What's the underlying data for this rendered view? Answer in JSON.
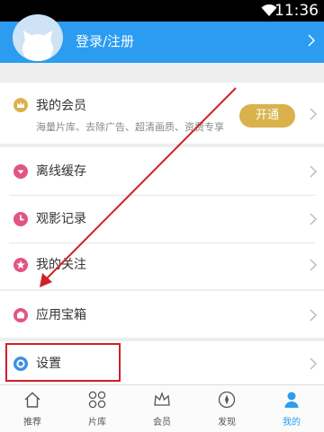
{
  "status_bar": {
    "time": "11:36",
    "wifi_icon": "wifi-icon"
  },
  "header": {
    "login_label": "登录/注册",
    "avatar_icon": "avatar-icon"
  },
  "membership": {
    "title": "我的会员",
    "subtitle": "海量片库、去除广告、超清画质、资费专享",
    "button_label": "开通",
    "icon": "crown-icon"
  },
  "menu": {
    "offline_cache": {
      "label": "离线缓存",
      "icon": "download-icon"
    },
    "history": {
      "label": "观影记录",
      "icon": "clock-icon"
    },
    "follows": {
      "label": "我的关注",
      "icon": "star-icon"
    },
    "app_box": {
      "label": "应用宝箱",
      "icon": "box-icon"
    },
    "settings": {
      "label": "设置",
      "icon": "gear-icon"
    }
  },
  "tabs": [
    {
      "label": "推荐",
      "icon": "home-icon"
    },
    {
      "label": "片库",
      "icon": "grid-icon"
    },
    {
      "label": "会员",
      "icon": "crown-icon"
    },
    {
      "label": "发现",
      "icon": "compass-icon"
    },
    {
      "label": "我的",
      "icon": "person-icon"
    }
  ],
  "active_tab": "我的",
  "colors": {
    "accent": "#2b9cf0",
    "gold": "#d9b24c",
    "pink": "#e05585",
    "annotation_red": "#d0202a"
  }
}
